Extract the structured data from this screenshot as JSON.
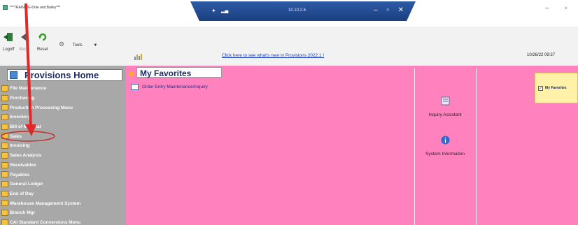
{
  "window": {
    "title": "***TRAINING-Dole and Bailey***",
    "rdp_address": "10.10.2.6",
    "rdp_controls": "– ▫ ✕",
    "window_controls": "– ▫"
  },
  "toolbar": {
    "logoff_label": "Logoff",
    "back_label": "Back",
    "reset_label": "Reset",
    "tools_label": "Tools",
    "news_link": "Click here to see what's new in Provisions 2022.1 !",
    "datetime": "10/26/22  09:37"
  },
  "sidebar": {
    "home_title": "Provisions Home",
    "items": [
      {
        "label": "File Maintenance"
      },
      {
        "label": "Purchasing"
      },
      {
        "label": "Production Processing Menu"
      },
      {
        "label": "Inventory"
      },
      {
        "label": "Bill of Material"
      },
      {
        "label": "Sales"
      },
      {
        "label": "Invoicing"
      },
      {
        "label": "Sales Analysis"
      },
      {
        "label": "Receivables"
      },
      {
        "label": "Payables"
      },
      {
        "label": "General Ledger"
      },
      {
        "label": "End of Day"
      },
      {
        "label": "Warehouse Management System"
      },
      {
        "label": "Branch Mgr"
      },
      {
        "label": "CAI Standard Conversions Menu"
      }
    ]
  },
  "main": {
    "favorites_title": "My Favorites",
    "favorites": [
      {
        "label": "Order Entry Maintenance/Inquiry"
      }
    ],
    "panel": {
      "inquiry_label": "Inquiry Assistant",
      "sysinfo_label": "System Information"
    },
    "fav_toggle_label": "My Favorites"
  },
  "colors": {
    "main_bg": "#ff82be",
    "sidebar_bg": "#a8a8a8",
    "annotation": "#e0282a"
  }
}
